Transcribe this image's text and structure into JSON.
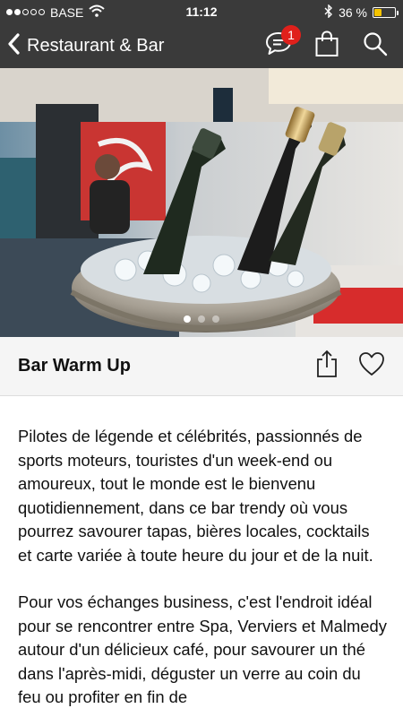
{
  "status": {
    "carrier": "BASE",
    "time": "11:12",
    "battery": "36 %",
    "battery_level": 0.36,
    "signal_bars": 2,
    "signal_total": 5
  },
  "nav": {
    "back_label": "Restaurant & Bar",
    "notification_count": "1"
  },
  "hero": {
    "slide_count": 3,
    "active_slide": 1
  },
  "detail": {
    "title": "Bar Warm Up",
    "paragraphs": [
      "Pilotes de légende et célébrités, passionnés de sports moteurs, touristes d'un week-end ou amoureux, tout le monde est le bienvenu quotidiennement, dans ce bar trendy où vous pourrez savourer tapas, bières locales, cocktails et carte variée à toute heure du jour et de la nuit.",
      "Pour vos échanges business, c'est l'endroit idéal pour se rencontrer entre Spa, Verviers et Malmedy autour d'un délicieux café, pour savourer un thé dans l'après-midi, déguster un verre au coin du feu ou profiter en fin de"
    ]
  },
  "icons": {
    "back": "chevron-left-icon",
    "chat": "chat-bubble-icon",
    "cart": "shopping-bag-icon",
    "search": "search-icon",
    "share": "share-icon",
    "favorite": "heart-icon",
    "wifi": "wifi-icon",
    "bluetooth": "bluetooth-icon"
  },
  "colors": {
    "bar_background": "#3a3a3a",
    "badge": "#e0201b",
    "battery_fill": "#f5c400",
    "title_background": "#f5f5f5"
  }
}
